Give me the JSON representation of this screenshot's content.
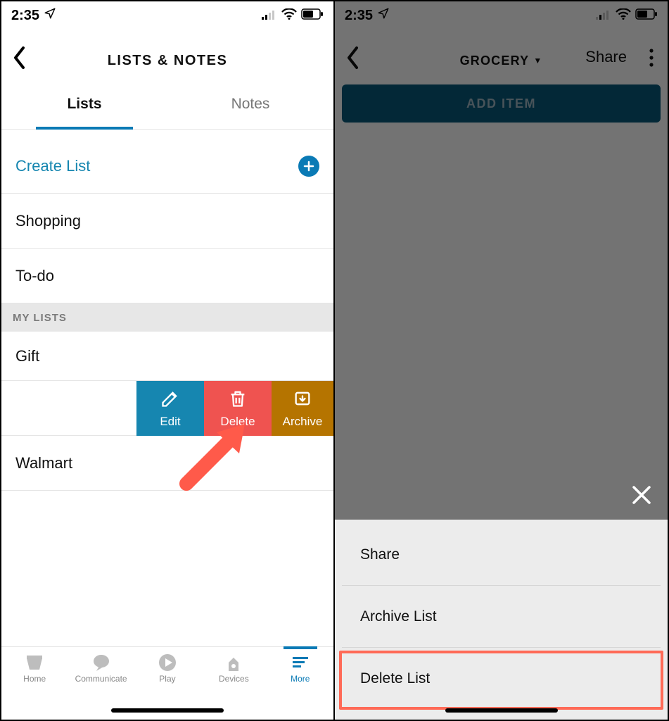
{
  "status": {
    "time": "2:35"
  },
  "left": {
    "header_title": "LISTS & NOTES",
    "tabs": {
      "lists": "Lists",
      "notes": "Notes"
    },
    "create_label": "Create List",
    "rows": {
      "shopping": "Shopping",
      "todo": "To-do",
      "gift": "Gift",
      "walmart": "Walmart"
    },
    "section_header": "MY LISTS",
    "swipe": {
      "edit": "Edit",
      "delete": "Delete",
      "archive": "Archive"
    },
    "tabbar": {
      "home": "Home",
      "communicate": "Communicate",
      "play": "Play",
      "devices": "Devices",
      "more": "More"
    }
  },
  "right": {
    "header_title": "GROCERY",
    "share_label": "Share",
    "add_item_label": "ADD ITEM",
    "sheet": {
      "share": "Share",
      "archive": "Archive List",
      "delete": "Delete List"
    }
  }
}
